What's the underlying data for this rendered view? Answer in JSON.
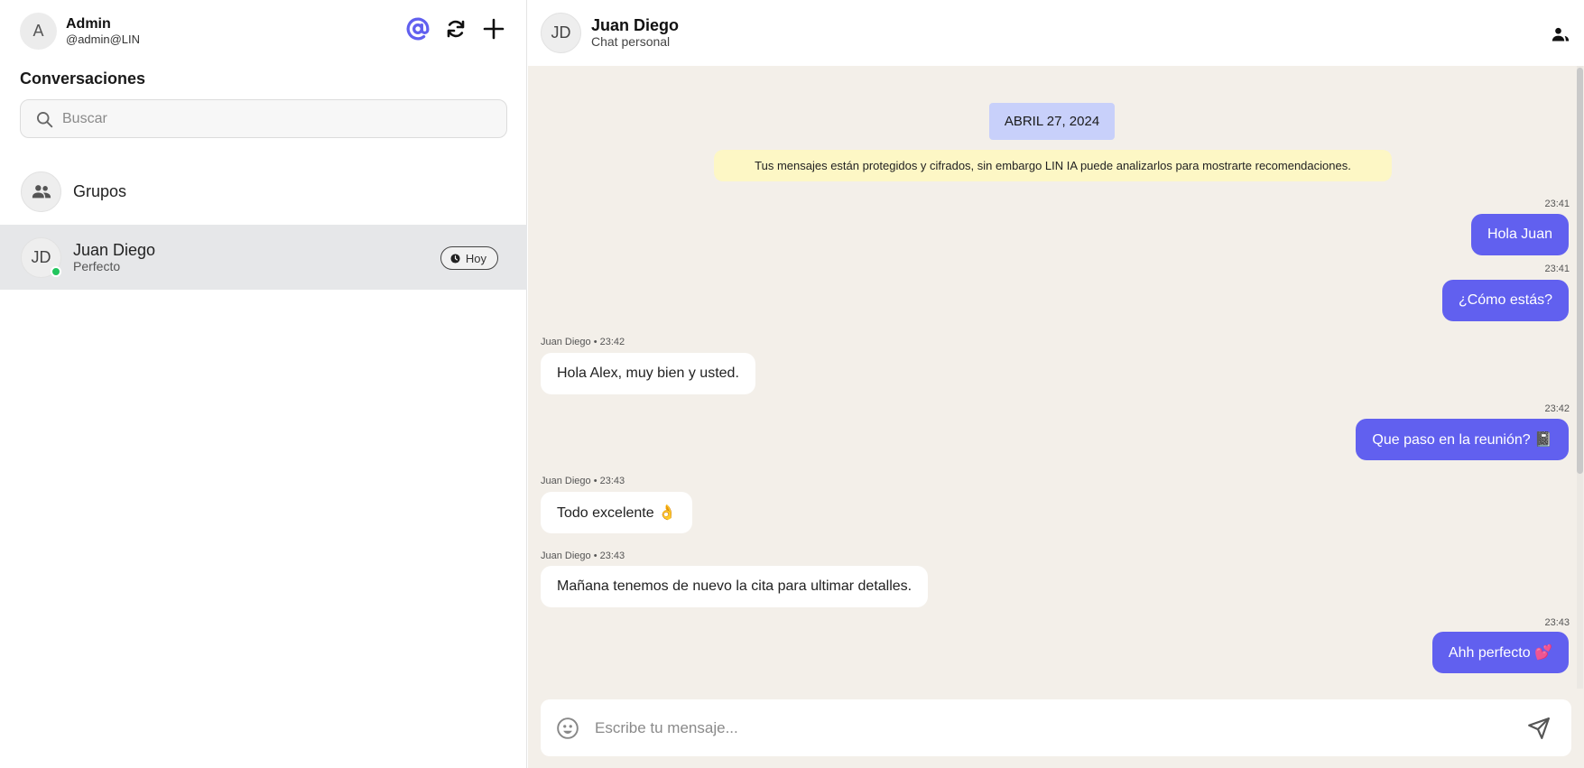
{
  "user": {
    "initial": "A",
    "name": "Admin",
    "handle": "@admin@LIN"
  },
  "sidebar": {
    "title": "Conversaciones",
    "search_placeholder": "Buscar",
    "groups_label": "Grupos",
    "conversations": [
      {
        "initials": "JD",
        "name": "Juan Diego",
        "preview": "Perfecto",
        "time": "Hoy",
        "online": true
      }
    ]
  },
  "chat": {
    "initials": "JD",
    "name": "Juan Diego",
    "subtitle": "Chat personal",
    "date": "ABRIL 27, 2024",
    "notice": "Tus mensajes están protegidos y cifrados, sin embargo LIN IA puede analizarlos para mostrarte recomendaciones.",
    "messages": [
      {
        "dir": "out",
        "time": "23:41",
        "text": "Hola Juan"
      },
      {
        "dir": "out",
        "time": "23:41",
        "text": "¿Cómo estás?"
      },
      {
        "dir": "in",
        "meta": "Juan Diego • 23:42",
        "text": "Hola Alex, muy bien y usted."
      },
      {
        "dir": "out",
        "time": "23:42",
        "text": "Que paso en la reunión? 📓"
      },
      {
        "dir": "in",
        "meta": "Juan Diego • 23:43",
        "text": "Todo excelente 👌"
      },
      {
        "dir": "in",
        "meta": "Juan Diego • 23:43",
        "text": "Mañana tenemos de nuevo la cita para ultimar detalles."
      },
      {
        "dir": "out",
        "time": "23:43",
        "text": "Ahh perfecto 💕"
      }
    ],
    "composer_placeholder": "Escribe tu mensaje..."
  },
  "colors": {
    "accent": "#6160ef",
    "date_pill": "#c8d0fa",
    "notice": "#fdf7c5",
    "chat_bg": "#f3efe9",
    "online": "#22c55e"
  },
  "icons": [
    "at-sign-icon",
    "refresh-icon",
    "plus-icon",
    "search-icon",
    "groups-icon",
    "clock-icon",
    "contacts-icon",
    "emoji-icon",
    "send-icon"
  ]
}
